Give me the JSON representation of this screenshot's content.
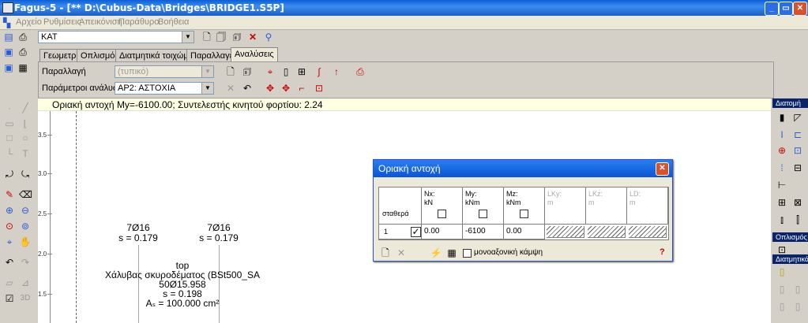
{
  "window": {
    "title": "Fagus-5 - [** D:\\Cubus-Data\\Bridges\\BRIDGE1.S5P]"
  },
  "menu": [
    "Αρχείο",
    "Ρυθμίσεις",
    "Απεικόνιση",
    "Παράθυρο",
    "Βοήθεια"
  ],
  "toolbar": {
    "section_combo": "ΚΑΤ"
  },
  "tabs": [
    "Γεωμετρία",
    "Οπλισμός",
    "Διατμητικά τοιχώματα",
    "Παραλλαγές",
    "Αναλύσεις"
  ],
  "analysis": {
    "variant_label": "Παραλλαγή",
    "variant_value": "(τυπικό)",
    "params_label": "Παράμετροι ανάλυσης",
    "params_value": "ΑΡ2: ΑΣΤΟΧΙΑ"
  },
  "status_text": "Οριακή αντοχή My=-6100.00; Συντελεστής κινητού φορτίου: 2.24",
  "y_ticks": [
    "3.5",
    "3.0",
    "2.5",
    "2.0",
    "1.5"
  ],
  "drawing": {
    "rebar_left": {
      "line1": "7Ø16",
      "line2": "s = 0.179"
    },
    "rebar_right": {
      "line1": "7Ø16",
      "line2": "s = 0.179"
    },
    "center": {
      "line1": "top",
      "line2": "Χάλυβας σκυροδέματος (BSt500_SA",
      "line3": "50Ø15.958",
      "line4": "s = 0.198",
      "line5": "Aₛ = 100.000 cm²"
    }
  },
  "right_panel": {
    "hdr1": "Διατομή",
    "hdr2": "Οπλισμός",
    "hdr3": "Διατμητικά"
  },
  "dialog": {
    "title": "Οριακή αντοχή",
    "columns": [
      {
        "top": "Nx:",
        "unit": "kN"
      },
      {
        "top": "My:",
        "unit": "kNm"
      },
      {
        "top": "Mz:",
        "unit": "kNm"
      },
      {
        "top": "LKy:",
        "unit": "m"
      },
      {
        "top": "LKz:",
        "unit": "m"
      },
      {
        "top": "LD:",
        "unit": "m"
      }
    ],
    "row_label": "σταθερά",
    "row": {
      "index": "1",
      "nx": "0.00",
      "my": "-6100",
      "mz": "0.00"
    },
    "mono_label": "μονοαξονική κάμψη",
    "help": "?"
  }
}
